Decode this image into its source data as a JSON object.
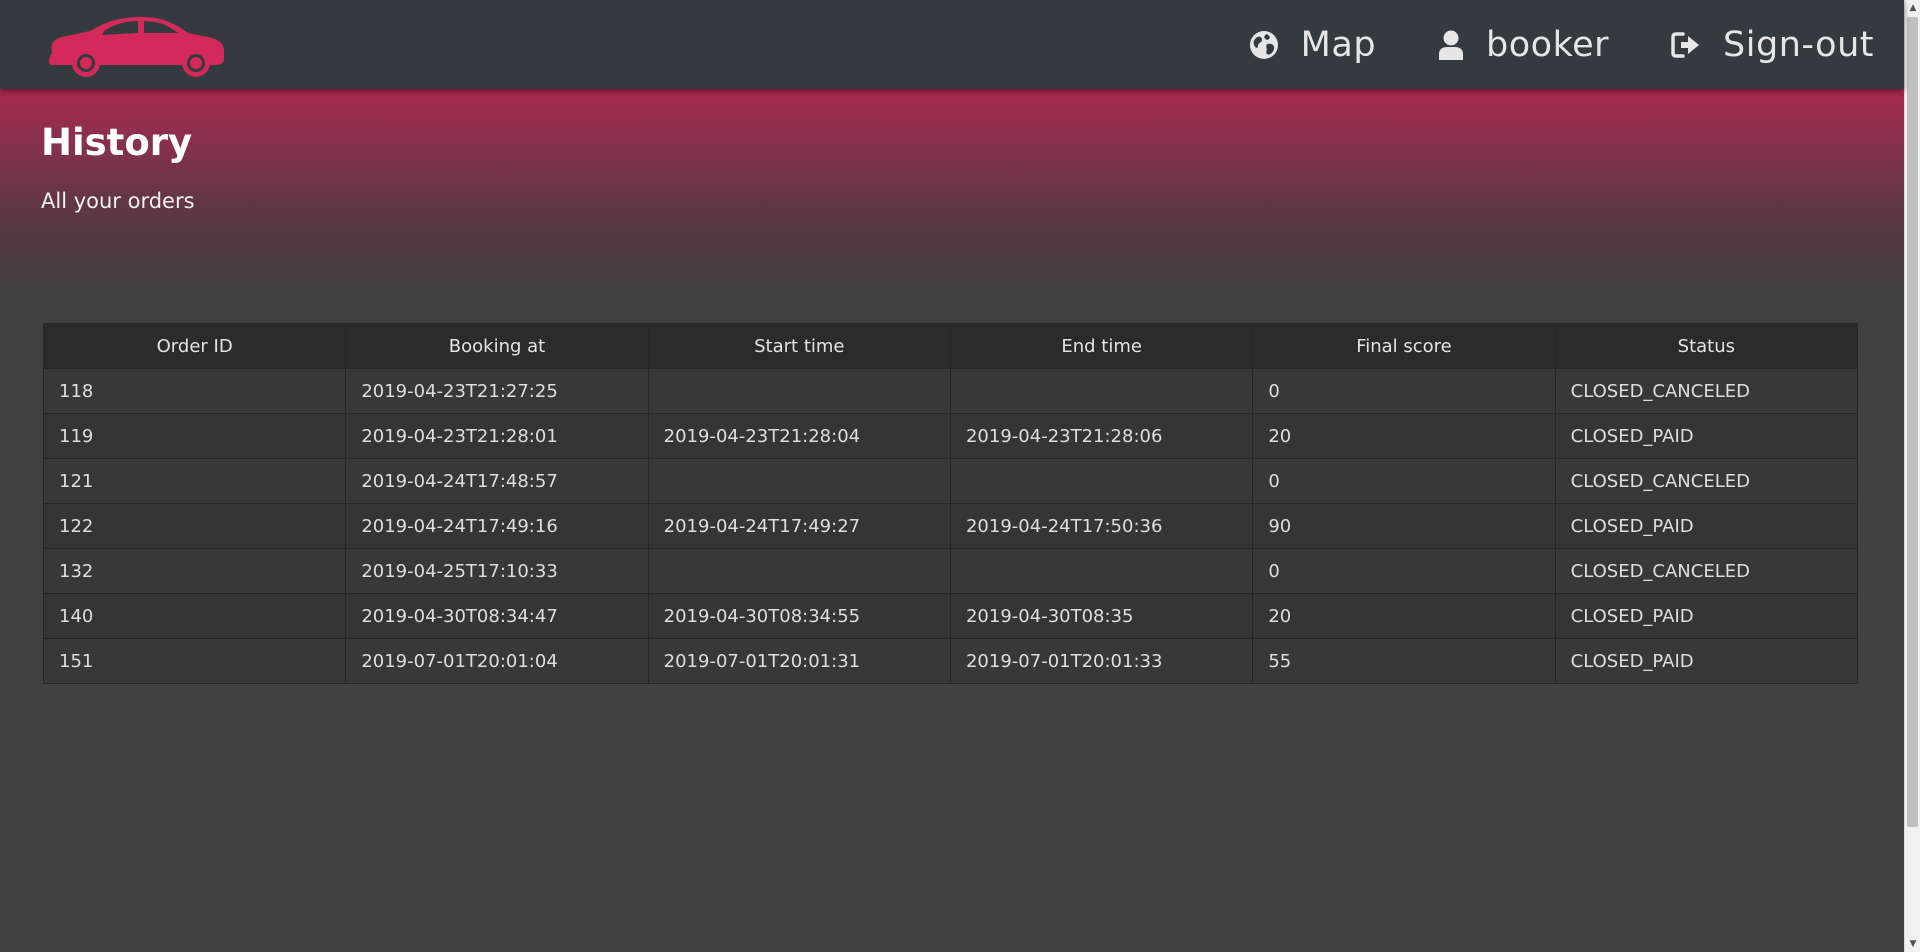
{
  "navbar": {
    "logo": "car-logo",
    "items": [
      {
        "label": "Map",
        "icon": "globe-icon"
      },
      {
        "label": "booker",
        "icon": "user-icon"
      },
      {
        "label": "Sign-out",
        "icon": "sign-out-icon"
      }
    ]
  },
  "hero": {
    "title": "History",
    "subtitle": "All your orders"
  },
  "orders_table": {
    "columns": [
      "Order ID",
      "Booking at",
      "Start time",
      "End time",
      "Final score",
      "Status"
    ],
    "rows": [
      [
        "118",
        "2019-04-23T21:27:25",
        "",
        "",
        "0",
        "CLOSED_CANCELED"
      ],
      [
        "119",
        "2019-04-23T21:28:01",
        "2019-04-23T21:28:04",
        "2019-04-23T21:28:06",
        "20",
        "CLOSED_PAID"
      ],
      [
        "121",
        "2019-04-24T17:48:57",
        "",
        "",
        "0",
        "CLOSED_CANCELED"
      ],
      [
        "122",
        "2019-04-24T17:49:16",
        "2019-04-24T17:49:27",
        "2019-04-24T17:50:36",
        "90",
        "CLOSED_PAID"
      ],
      [
        "132",
        "2019-04-25T17:10:33",
        "",
        "",
        "0",
        "CLOSED_CANCELED"
      ],
      [
        "140",
        "2019-04-30T08:34:47",
        "2019-04-30T08:34:55",
        "2019-04-30T08:35",
        "20",
        "CLOSED_PAID"
      ],
      [
        "151",
        "2019-07-01T20:01:04",
        "2019-07-01T20:01:31",
        "2019-07-01T20:01:33",
        "55",
        "CLOSED_PAID"
      ]
    ]
  },
  "colors": {
    "brand": "#d42a5b",
    "navbar_bg": "#343a3e",
    "page_bg": "#414141",
    "hero_top": "#a82a50"
  },
  "scrollbar": {
    "up_arrow": "▲",
    "down_arrow": "▼"
  }
}
